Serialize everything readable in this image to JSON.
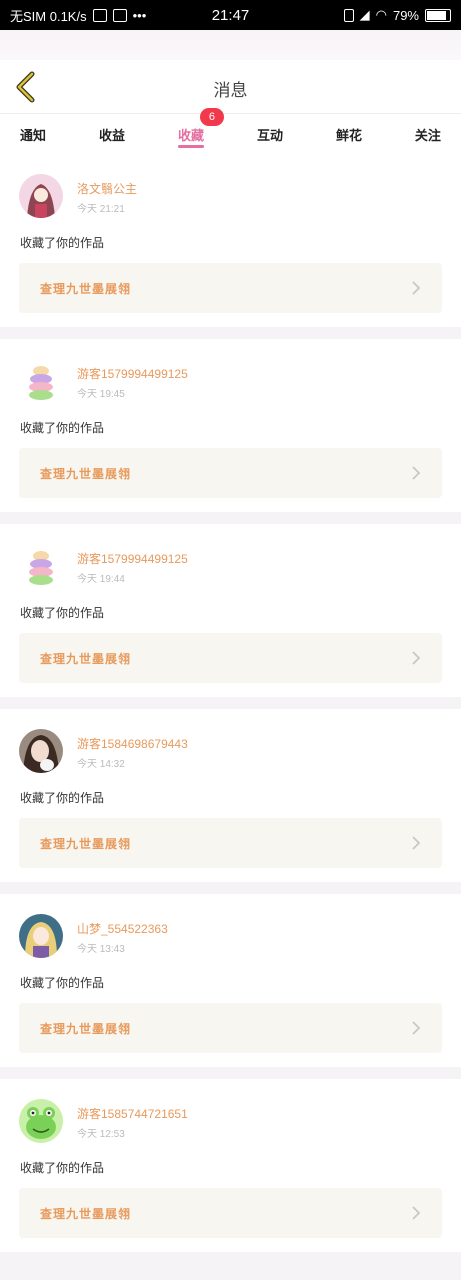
{
  "status_bar": {
    "left_text": "无SIM 0.1K/s",
    "time": "21:47",
    "battery": "79%"
  },
  "header": {
    "title": "消息"
  },
  "tabs": [
    {
      "label": "通知"
    },
    {
      "label": "收益"
    },
    {
      "label": "收藏",
      "badge": "6",
      "active": true
    },
    {
      "label": "互动"
    },
    {
      "label": "鲜花"
    },
    {
      "label": "关注"
    }
  ],
  "messages": [
    {
      "user": "洛文翳公主",
      "time": "今天 21:21",
      "action": "收藏了你的作品",
      "work": "查理九世墨展翎",
      "avatar_icon": "anime-girl-avatar"
    },
    {
      "user": "游客1579994499125",
      "time": "今天 19:45",
      "action": "收藏了你的作品",
      "work": "查理九世墨展翎",
      "avatar_icon": "macaron-stack-avatar"
    },
    {
      "user": "游客1579994499125",
      "time": "今天 19:44",
      "action": "收藏了你的作品",
      "work": "查理九世墨展翎",
      "avatar_icon": "macaron-stack-avatar"
    },
    {
      "user": "游客1584698679443",
      "time": "今天 14:32",
      "action": "收藏了你的作品",
      "work": "查理九世墨展翎",
      "avatar_icon": "photo-girl-avatar"
    },
    {
      "user": "山梦_554522363",
      "time": "今天 13:43",
      "action": "收藏了你的作品",
      "work": "查理九世墨展翎",
      "avatar_icon": "anime-blonde-avatar"
    },
    {
      "user": "游客1585744721651",
      "time": "今天 12:53",
      "action": "收藏了你的作品",
      "work": "查理九世墨展翎",
      "avatar_icon": "green-frog-avatar"
    }
  ],
  "colors": {
    "accent": "#e46fa0",
    "username": "#e89a5d",
    "badge": "#f2394b",
    "back_arrow": "#c9b22a"
  }
}
